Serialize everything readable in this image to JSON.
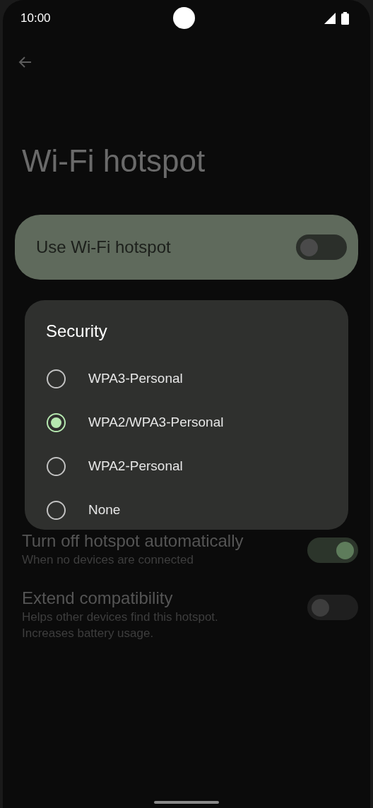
{
  "status_bar": {
    "time": "10:00"
  },
  "title": "Wi-Fi hotspot",
  "main_toggle": {
    "label": "Use Wi-Fi hotspot",
    "on": false
  },
  "dialog": {
    "title": "Security",
    "options": [
      {
        "label": "WPA3-Personal",
        "selected": false
      },
      {
        "label": "WPA2/WPA3-Personal",
        "selected": true
      },
      {
        "label": "WPA2-Personal",
        "selected": false
      },
      {
        "label": "None",
        "selected": false
      }
    ]
  },
  "settings": [
    {
      "title": "Turn off hotspot automatically",
      "subtitle": "When no devices are connected",
      "on": true
    },
    {
      "title": "Extend compatibility",
      "subtitle": "Helps other devices find this hotspot.\nIncreases battery usage.",
      "on": false
    }
  ]
}
